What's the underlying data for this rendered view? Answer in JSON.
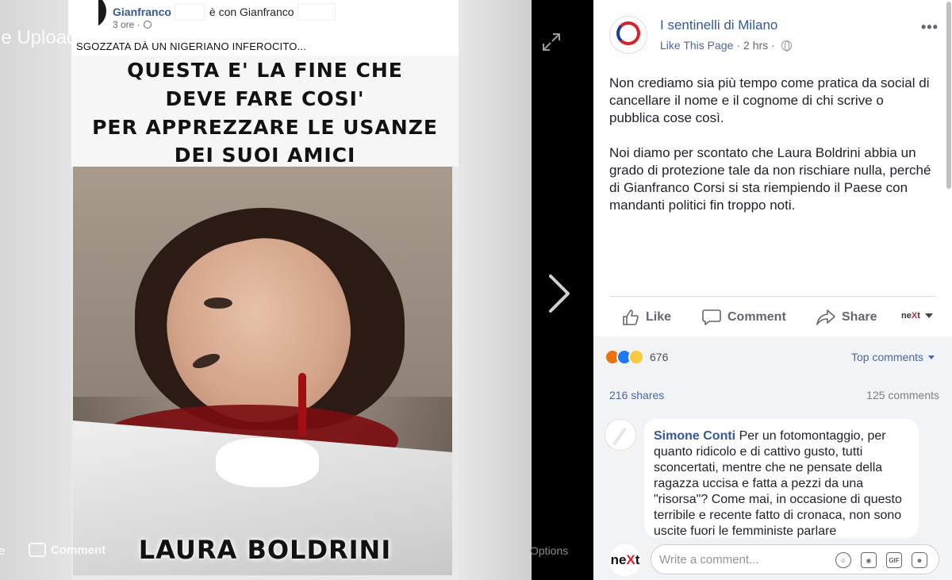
{
  "viewer": {
    "ghost_uploads": "le Uploads",
    "ghost_comment": "Comment",
    "ghost_options": "Options",
    "ghost_e": "e",
    "embedded_post": {
      "author": "Gianfranco",
      "with_text": "è con Gianfranco",
      "time": "3 ore ·",
      "caption": "SGOZZATA DÀ UN NIGERIANO INFEROCITO...",
      "meme_lines": [
        "QUESTA E' LA FINE CHE",
        "DEVE FARE COSI'",
        "PER APPREZZARE LE USANZE",
        "DEI SUOI AMICI"
      ],
      "meme_name": "LAURA BOLDRINI"
    }
  },
  "post": {
    "page_name": "I sentinelli di Milano",
    "like_page": "Like This Page",
    "time": "2 hrs",
    "more": "•••",
    "paragraphs": [
      "Non crediamo sia più tempo come pratica da social di cancellare il nome e il cognome di chi scrive o pubblica cose così.",
      "Noi diamo per scontato che Laura Boldrini abbia un grado di protezione tale da non rischiare nulla, perché di Gianfranco Corsi si sta riempiendo il Paese con mandanti politici fin troppo noti."
    ],
    "actions": {
      "like": "Like",
      "comment": "Comment",
      "share": "Share",
      "next_a": "ne",
      "next_x": "X",
      "next_b": "t"
    },
    "reaction_count": "676",
    "top_comments": "Top comments",
    "shares": "216 shares",
    "comments_count": "125 comments",
    "comment": {
      "author": "Simone Conti",
      "text": "Per un fotomontaggio, per quanto ridicolo e di cattivo gusto, tutti sconcertati, mentre che ne pensate della ragazza uccisa e fatta a pezzi da una \"risorsa\"? Come mai, in occasione di questo terribile e recente fatto di cronaca, non sono uscite fuori le femministe parlare"
    },
    "composer": {
      "placeholder": "Write a comment...",
      "logo_a": "ne",
      "logo_x": "X",
      "logo_b": "t",
      "gif": "GIF"
    }
  },
  "colors": {
    "link": "#365899",
    "muted": "#616770",
    "panel_bg": "#f2f3f5"
  }
}
